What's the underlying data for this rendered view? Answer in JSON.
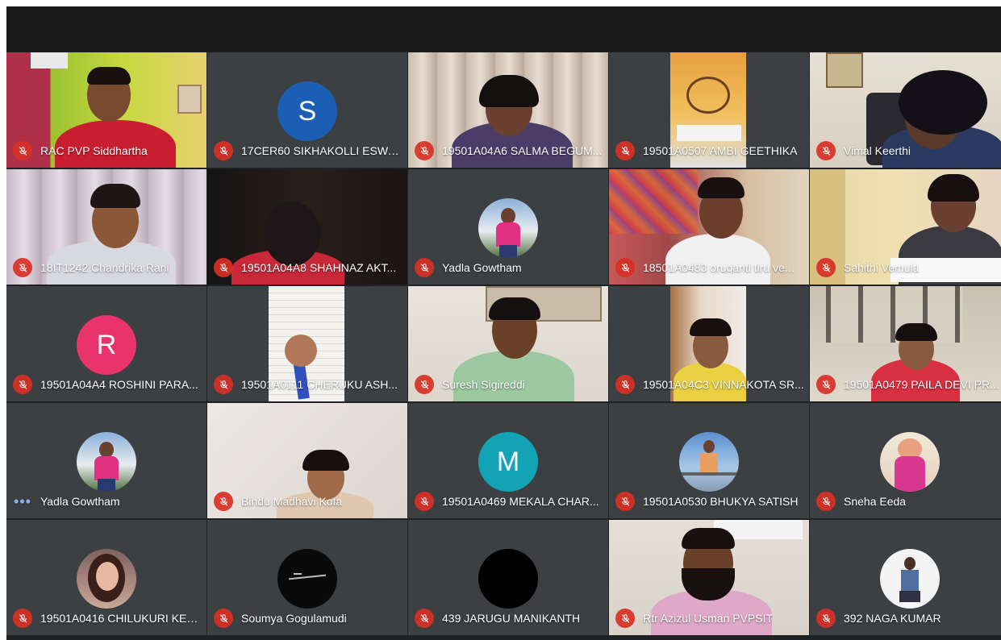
{
  "participants": [
    {
      "name": "RAC PVP Siddhartha"
    },
    {
      "name": "17CER60 SIKHAKOLLI ESWA...",
      "avatar_letter": "S",
      "avatar_color": "#1a5fb4"
    },
    {
      "name": "19501A04A6 SALMA BEGUM..."
    },
    {
      "name": "19501A0507 AMBI GEETHIKA"
    },
    {
      "name": "Vimal Keerthi"
    },
    {
      "name": "18IT1242 Chandrika Rani"
    },
    {
      "name": "19501A04A8 SHAHNAZ AKT..."
    },
    {
      "name": "Yadla Gowtham"
    },
    {
      "name": "18501A0483 oruganti tiru ve..."
    },
    {
      "name": "Sahithi Vemula"
    },
    {
      "name": "19501A04A4 ROSHINI PARA...",
      "avatar_letter": "R",
      "avatar_color": "#e8336d"
    },
    {
      "name": "19501A0111 CHERUKU ASH..."
    },
    {
      "name": "Suresh Sigireddi"
    },
    {
      "name": "19501A04C3 VINNAKOTA SR..."
    },
    {
      "name": "19501A0479 PAILA DEVI PR..."
    },
    {
      "name": "Yadla Gowtham"
    },
    {
      "name": "Bindu Madhavi Kota"
    },
    {
      "name": "19501A0469 MEKALA CHAR...",
      "avatar_letter": "M",
      "avatar_color": "#12a4b5"
    },
    {
      "name": "19501A0530 BHUKYA SATISH"
    },
    {
      "name": "Sneha Eeda"
    },
    {
      "name": "19501A0416 CHILUKURI KEE..."
    },
    {
      "name": "Soumya Gogulamudi"
    },
    {
      "name": "439 JARUGU MANIKANTH"
    },
    {
      "name": "Rtr Azizul Usman PVPSIT"
    },
    {
      "name": "392 NAGA KUMAR"
    }
  ],
  "icons": {
    "muted": "mic-off-icon",
    "more": "more-options-icon"
  },
  "colors": {
    "mute_red": "#d93025",
    "more_blue": "#8ab4f8",
    "tile_bg": "#3c4043"
  }
}
